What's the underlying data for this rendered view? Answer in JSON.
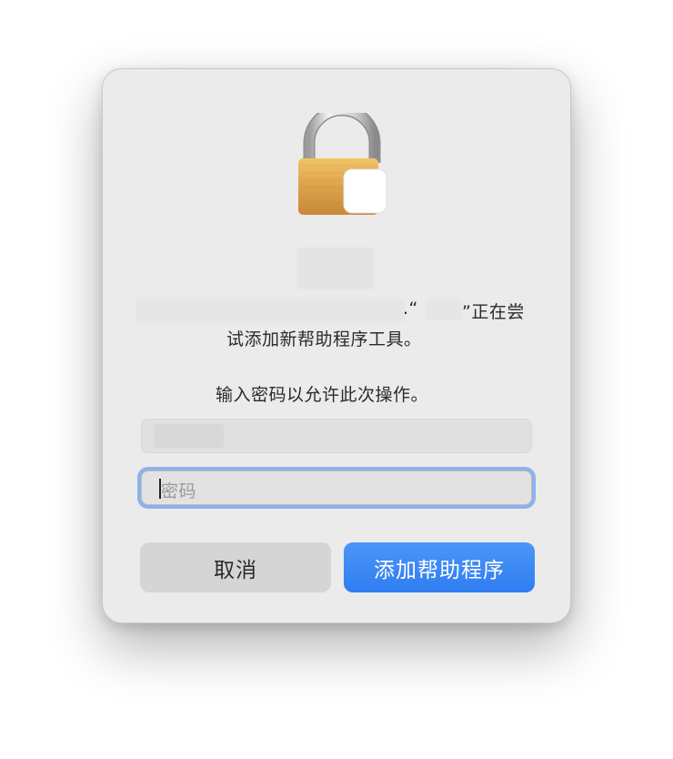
{
  "dialog": {
    "message_line1_prefix": ".“",
    "message_line1_suffix": "”正在尝",
    "message_line2": "试添加新帮助程序工具。",
    "prompt": "输入密码以允许此次操作。",
    "password_placeholder": "密码",
    "cancel_label": "取消",
    "confirm_label": "添加帮助程序"
  },
  "colors": {
    "accent": "#3584f4",
    "focus_ring": "#8fb0ec",
    "dialog_bg": "#ebebeb"
  },
  "icons": {
    "lock": "padlock-icon"
  }
}
